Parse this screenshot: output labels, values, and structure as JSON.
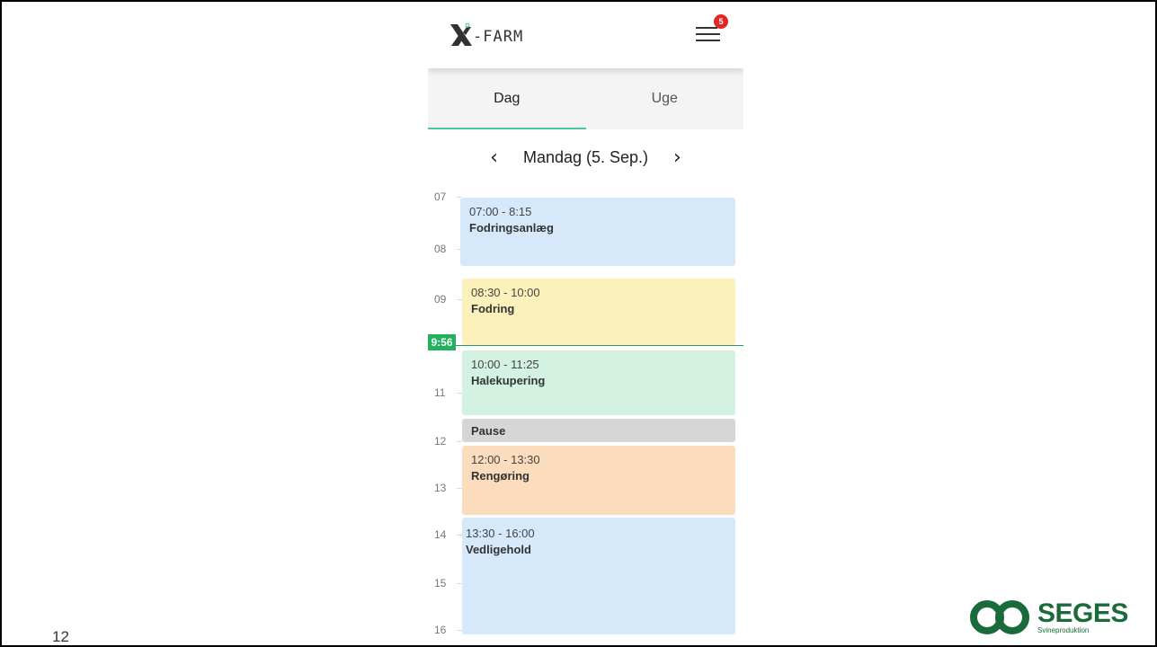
{
  "app": {
    "logo_text": "-FARM",
    "notification_count": "5",
    "colors": {
      "accent": "#4cc79a",
      "badge": "#e32626",
      "now": "#22b25f"
    }
  },
  "tabs": [
    {
      "label": "Dag",
      "active": true
    },
    {
      "label": "Uge",
      "active": false
    }
  ],
  "day_nav": {
    "prev_icon": "chevron-left-icon",
    "label": "Mandag (5. Sep.)",
    "next_icon": "chevron-right-icon"
  },
  "hours": [
    "07",
    "08",
    "09",
    "11",
    "12",
    "13",
    "14",
    "15",
    "16"
  ],
  "now_marker": "9:56",
  "events": [
    {
      "time": "07:00 - 8:15",
      "title": "Fodringsanlæg",
      "color": "#d6e9fb"
    },
    {
      "time": "08:30 - 10:00",
      "title": "Fodring",
      "color": "#fdf1bb"
    },
    {
      "time": "10:00 - 11:25",
      "title": "Halekupering",
      "color": "#d4f2e1"
    },
    {
      "time": "",
      "title": "Pause",
      "color": "#d6d6d6"
    },
    {
      "time": "12:00 - 13:30",
      "title": "Rengøring",
      "color": "#fbdcbc"
    },
    {
      "time": "13:30 - 16:00",
      "title": "Vedligehold",
      "color": "#d6e9fb"
    }
  ],
  "slide": {
    "page_number": "12",
    "brand_name": "SEGES",
    "brand_sub": "Svineproduktion"
  }
}
